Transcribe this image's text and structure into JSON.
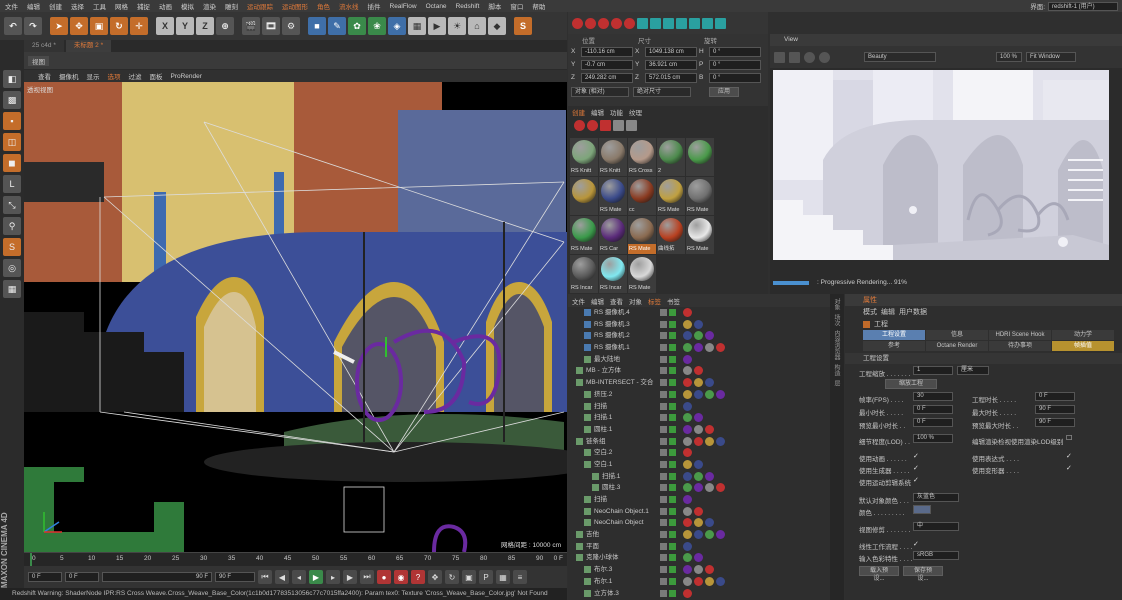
{
  "menubar": {
    "items": [
      "文件",
      "编辑",
      "创建",
      "选择",
      "工具",
      "网格",
      "捕捉",
      "动画",
      "模拟",
      "渲染",
      "雕刻",
      "运动跟踪",
      "运动图形",
      "角色",
      "流水线",
      "插件",
      "RealFlow",
      "Octane",
      "Redshift",
      "脚本",
      "窗口",
      "帮助"
    ],
    "highlighted": [
      "运动跟踪",
      "运动图形",
      "角色",
      "流水线"
    ],
    "layout_label": "界面:",
    "layout_value": "redshift-1 (用户)"
  },
  "toolbar": {
    "axis_x": "X",
    "axis_y": "Y",
    "axis_z": "Z"
  },
  "doc_tabs": [
    {
      "label": "25 c4d *",
      "active": false
    },
    {
      "label": "未标题 2 *",
      "active": true
    }
  ],
  "viewport": {
    "title": "视图",
    "menu": [
      "查看",
      "摄像机",
      "显示",
      "选项",
      "过滤",
      "面板",
      "ProRender"
    ],
    "active_menu": "选项",
    "label": "透视视图",
    "grid_spacing": "网格间距 : 10000 cm"
  },
  "timeline": {
    "ticks": [
      "0",
      "5",
      "10",
      "15",
      "20",
      "25",
      "30",
      "35",
      "40",
      "45",
      "50",
      "55",
      "60",
      "65",
      "70",
      "75",
      "80",
      "85",
      "90"
    ],
    "end_frame": "0 F"
  },
  "transport": {
    "start": "0 F",
    "current": "0 F",
    "end_mini": "90 F",
    "end": "90 F"
  },
  "statusbar": "Redshift Warning: ShaderNode IPR:RS Cross Weave.Cross_Weave_Base_Color(1c1b0d17783513056c77c7015ffa2400): Param tex0: Texture 'Cross_Weave_Base_Color.jpg' Not Found",
  "logo": "MAXON CINEMA 4D",
  "coords": {
    "headers": [
      "位置",
      "尺寸",
      "旋转"
    ],
    "rows": [
      {
        "axis": "X",
        "pos": "-110.16 cm",
        "size_axis": "X",
        "size": "1049.138 cm",
        "rot_axis": "H",
        "rot": "0 °"
      },
      {
        "axis": "Y",
        "pos": "-0.7 cm",
        "size_axis": "Y",
        "size": "36.921 cm",
        "rot_axis": "P",
        "rot": "0 °"
      },
      {
        "axis": "Z",
        "pos": "249.282 cm",
        "size_axis": "Z",
        "size": "572.015 cm",
        "rot_axis": "B",
        "rot": "0 °"
      }
    ],
    "mode": "对象 (相对)",
    "size_mode": "绝对尺寸",
    "apply": "应用"
  },
  "material_manager": {
    "tabs": [
      "创建",
      "编辑",
      "功能",
      "纹理"
    ],
    "materials": [
      {
        "label": "RS Knitt",
        "color": "#7da57a",
        "selected": false
      },
      {
        "label": "RS Knitt",
        "color": "#8a7a6a",
        "selected": false
      },
      {
        "label": "RS Cross",
        "color": "#b59a8a",
        "selected": false
      },
      {
        "label": "2",
        "color": "#4c8a4c",
        "selected": false
      },
      {
        "label": "",
        "color": "#4a9a4a",
        "selected": false
      },
      {
        "label": "",
        "color": "#b8953a",
        "selected": false
      },
      {
        "label": "RS Mate",
        "color": "#3a4a8a",
        "selected": false
      },
      {
        "label": "cc",
        "color": "#8a3a20",
        "selected": false
      },
      {
        "label": "RS Mate",
        "color": "#c0a040",
        "selected": false
      },
      {
        "label": "RS Mate",
        "color": "#707070",
        "selected": false
      },
      {
        "label": "RS Mate",
        "color": "#3a9a4a",
        "selected": false
      },
      {
        "label": "RS Car",
        "color": "#5a2a7a",
        "selected": false
      },
      {
        "label": "RS Mate",
        "color": "#8a6a50",
        "selected": true
      },
      {
        "label": "曲线拓",
        "color": "#b84020",
        "selected": false
      },
      {
        "label": "RS Mate",
        "color": "#e8e8e8",
        "selected": false
      },
      {
        "label": "RS Incar",
        "color": "#5a5a5a",
        "selected": false
      },
      {
        "label": "RS Incar",
        "color": "#80e8f0",
        "selected": false
      },
      {
        "label": "RS Mate",
        "color": "#d8d8d8",
        "selected": false
      }
    ]
  },
  "object_manager": {
    "tabs": [
      "文件",
      "编辑",
      "查看",
      "对象",
      "标签",
      "书签"
    ],
    "active_tab": "标签",
    "objects": [
      {
        "name": "RS 摄像机.4",
        "indent": 1
      },
      {
        "name": "RS 摄像机.3",
        "indent": 1
      },
      {
        "name": "RS 摄像机.2",
        "indent": 1
      },
      {
        "name": "RS 摄像机.1",
        "indent": 1
      },
      {
        "name": "最大陆地",
        "indent": 1
      },
      {
        "name": "MB - 立方体",
        "indent": 0
      },
      {
        "name": "MB-INTERSECT - 交合",
        "indent": 0
      },
      {
        "name": "挤压.2",
        "indent": 1
      },
      {
        "name": "扫描",
        "indent": 1
      },
      {
        "name": "扫描.1",
        "indent": 1
      },
      {
        "name": "圆柱.1",
        "indent": 1
      },
      {
        "name": "链条组",
        "indent": 0
      },
      {
        "name": "空白.2",
        "indent": 1
      },
      {
        "name": "空白.1",
        "indent": 1
      },
      {
        "name": "扫描.1",
        "indent": 2
      },
      {
        "name": "圆柱.3",
        "indent": 2
      },
      {
        "name": "扫描",
        "indent": 1
      },
      {
        "name": "NeoChain Object.1",
        "indent": 1
      },
      {
        "name": "NeoChain Object",
        "indent": 1
      },
      {
        "name": "吉他",
        "indent": 0
      },
      {
        "name": "平面",
        "indent": 0
      },
      {
        "name": "克隆小球体",
        "indent": 0
      },
      {
        "name": "布尔.3",
        "indent": 1
      },
      {
        "name": "布尔.1",
        "indent": 1
      },
      {
        "name": "立方体.3",
        "indent": 1
      }
    ]
  },
  "render_view": {
    "title": "View",
    "pass": "Beauty",
    "zoom": "100 %",
    "fit": "Fit Window",
    "status": ": Progressive Rendering... 91%",
    "progress": 0.91
  },
  "attributes": {
    "title": "属性",
    "menu": [
      "模式",
      "编辑",
      "用户数据"
    ],
    "object_label": "工程",
    "tabs": [
      "工程设置",
      "信息",
      "HDRI Scene Hook",
      "动力学",
      "参考",
      "Octane Render",
      "待办事项",
      "帧插值"
    ],
    "active_tab": "工程设置",
    "active_tab2": "帧插值",
    "section": "工程设置",
    "scale_label": "工程缩放 . . . . . . .",
    "scale_value": "1",
    "scale_unit": "厘米",
    "scale_button": "缩放工程",
    "left_fields": [
      {
        "label": "帧率(FPS) . . . .",
        "value": "30"
      },
      {
        "label": "最小时长 . . . . .",
        "value": "0 F"
      },
      {
        "label": "预览最小时长 . .",
        "value": "0 F"
      },
      {
        "label": "细节程度(LOD) . .",
        "value": "100 %"
      }
    ],
    "right_fields": [
      {
        "label": "工程时长 . . . . .",
        "value": "0 F"
      },
      {
        "label": "最大时长 . . . . .",
        "value": "90 F"
      },
      {
        "label": "预览最大时长 . .",
        "value": "90 F"
      }
    ],
    "lod_note": "编辑渲染检视使用渲染LOD级别",
    "checks_left": [
      "使用动画 . . . . . .",
      "使用生成器 . . . . .",
      "使用运动剪辑系统"
    ],
    "checks_right": [
      "使用表达式 . . . .",
      "使用变形器 . . . ."
    ],
    "default_color_label": "默认对象颜色 . . .",
    "default_color_value": "灰蓝色",
    "color_label": "颜色 . . . . . . . . .",
    "clip_label": "视图修剪 . . . . . . .",
    "clip_value": "中",
    "linear_label": "线性工作流程 . . . .",
    "input_label": "输入色彩特性 . . . .",
    "input_value": "sRGB",
    "load_btn": "载入预设...",
    "save_btn": "保存预设..."
  },
  "side_tabs": [
    "对象",
    "场次",
    "内容浏览器",
    "构造",
    "层"
  ]
}
